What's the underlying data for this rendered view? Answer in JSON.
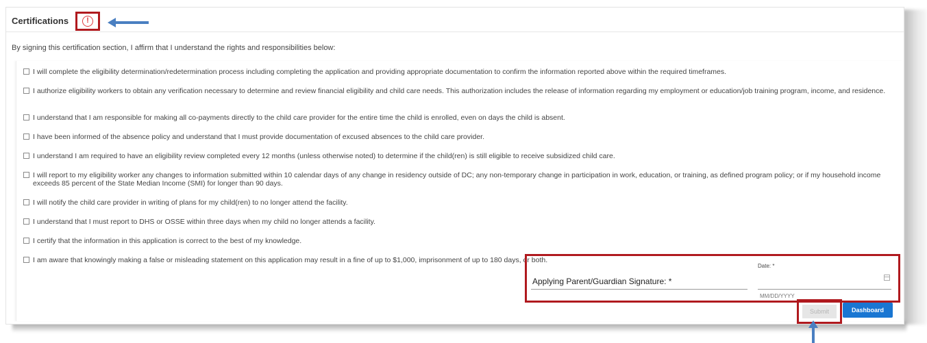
{
  "section": {
    "title": "Certifications",
    "warning_glyph": "!",
    "intro": "By signing this certification section, I affirm that I understand the rights and responsibilities below:"
  },
  "certifications": [
    "I will complete the eligibility determination/redetermination process including completing the application and providing appropriate documentation to confirm the information reported above within the required timeframes.",
    "I authorize eligibility workers to obtain any verification necessary to determine and review financial eligibility and child care needs. This authorization includes the release of information regarding my employment or education/job training program, income, and residence.",
    "I understand that I am responsible for making all co-payments directly to the child care provider for the entire time the child is enrolled, even on days the child is absent.",
    "I have been informed of the absence policy and understand that I must provide documentation of excused absences to the child care provider.",
    "I understand I am required to have an eligibility review completed every 12 months (unless otherwise noted) to determine if the child(ren) is still eligible to receive subsidized child care.",
    "I will report to my eligibility worker any changes to information submitted within 10 calendar days of any change in residency outside of DC; any non-temporary change in participation in work, education, or training, as defined program policy; or if my household income exceeds 85 percent of the State Median Income (SMI) for longer than 90 days.",
    "I will notify the child care provider in writing of plans for my child(ren) to no longer attend the facility.",
    "I understand that I must report to DHS or OSSE within three days when my child no longer attends a facility.",
    "I certify that the information in this application is correct to the best of my knowledge.",
    "I am aware that knowingly making a false or misleading statement on this application may result in a fine of up to $1,000, imprisonment of up to 180 days, or both."
  ],
  "signature": {
    "label": "Applying Parent/Guardian Signature: *",
    "date_label": "Date: *",
    "date_placeholder": "MM/DD/YYYY"
  },
  "actions": {
    "submit_label": "Submit",
    "dashboard_label": "Dashboard"
  },
  "colors": {
    "highlight": "#b0191e",
    "warning": "#e0393e",
    "primary": "#1976d2",
    "annotation_arrow": "#4a7fc1"
  },
  "icons": {
    "warning": "warning-circle-icon",
    "calendar": "calendar-icon",
    "checkbox": "checkbox-icon"
  }
}
